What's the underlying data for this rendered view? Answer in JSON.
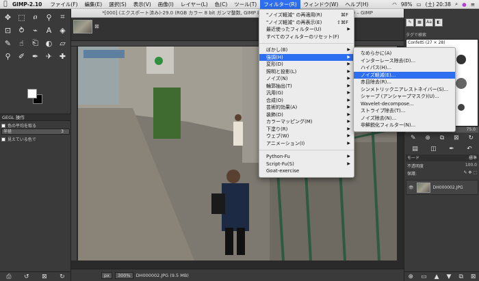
{
  "menubar": {
    "app": "GIMP-2.10",
    "items": [
      "ファイル(F)",
      "編集(E)",
      "選択(S)",
      "表示(V)",
      "画像(I)",
      "レイヤー(L)",
      "色(C)",
      "ツール(T)",
      "フィルター(R)",
      "ウィンドウ(W)",
      "ヘルプ(H)"
    ],
    "active_index": 8,
    "battery": "98%",
    "time": "(土) 20:38"
  },
  "window_title": "*[000] (エクスポート済み)-29.0 (RGB カラー 8 bit ガンマ整数, GIMP built-in sRGB, 1 枚のレイヤー) 5680x3800 – GIMP",
  "toolbox": {
    "tools": [
      "move",
      "rect-select",
      "lasso",
      "fuzzy-select",
      "crop",
      "unified-transform",
      "warp",
      "paint-select",
      "text",
      "bucket-fill",
      "paintbrush",
      "smudge",
      "clone",
      "dodge",
      "eraser",
      "zoom",
      "color-picker",
      "path",
      "airbrush",
      "heal"
    ],
    "gegl_tab": "GEGL 操作",
    "option1": "色の平均を取る",
    "field_label": "半径",
    "field_value": "3",
    "option2": "見えている色で"
  },
  "image_window": {
    "status_unit": "px",
    "zoom": "300%",
    "filename": "DH000002.JPG (9.5 MB)"
  },
  "dock": {
    "tag_placeholder": "タグで検索",
    "brush_name": "Confetti (27 × 28)",
    "brush_value": "75.0",
    "mode_label": "モード",
    "mode_value": "標準",
    "opacity_label": "不透明度",
    "opacity_value": "100.0",
    "lock_label": "保護:",
    "layer_name": "DH000002.JPG"
  },
  "filter_menu": {
    "top": [
      {
        "label": "\"ノイズ軽減\" の再適用(R)",
        "shortcut": "⌘F"
      },
      {
        "label": "\"ノイズ軽減\" の再表示(E)",
        "shortcut": "⇧⌘F"
      },
      {
        "label": "最近使ったフィルター(U)",
        "submenu": true
      },
      {
        "label": "すべてのフィルターのリセット(F)"
      }
    ],
    "groups": [
      {
        "label": "ぼかし(B)",
        "submenu": true
      },
      {
        "label": "強調(H)",
        "submenu": true,
        "highlighted": true
      },
      {
        "label": "変形(D)",
        "submenu": true
      },
      {
        "label": "照明と投影(L)",
        "submenu": true
      },
      {
        "label": "ノイズ(N)",
        "submenu": true
      },
      {
        "label": "輪郭抽出(T)",
        "submenu": true
      },
      {
        "label": "汎用(G)",
        "submenu": true
      },
      {
        "label": "合成(O)",
        "submenu": true
      },
      {
        "label": "芸術的効果(A)",
        "submenu": true
      },
      {
        "label": "装飾(D)",
        "submenu": true
      },
      {
        "label": "カラーマッピング(M)",
        "submenu": true
      },
      {
        "label": "下塗り(R)",
        "submenu": true
      },
      {
        "label": "ウェブ(W)",
        "submenu": true
      },
      {
        "label": "アニメーション(I)",
        "submenu": true
      }
    ],
    "scripts": [
      {
        "label": "Python-Fu",
        "submenu": true
      },
      {
        "label": "Script-Fu(S)",
        "submenu": true
      },
      {
        "label": "Goat-exercise"
      }
    ]
  },
  "enhance_submenu": [
    {
      "label": "なめらかに(A)"
    },
    {
      "label": "インターレース除去(D)..."
    },
    {
      "label": "ハイパス(H)..."
    },
    {
      "label": "ノイズ軽減(E)...",
      "highlighted": true
    },
    {
      "label": "赤目除去(R)..."
    },
    {
      "label": "シンメトリックニアレストネイバー(S)..."
    },
    {
      "label": "シャープ (アンシャープマスク)(U)..."
    },
    {
      "label": "Wavelet-decompose..."
    },
    {
      "label": "ストライプ除去(T)..."
    },
    {
      "label": "ノイズ除去(N)..."
    },
    {
      "label": "非鮮鋭化フィルター(N)..."
    }
  ]
}
